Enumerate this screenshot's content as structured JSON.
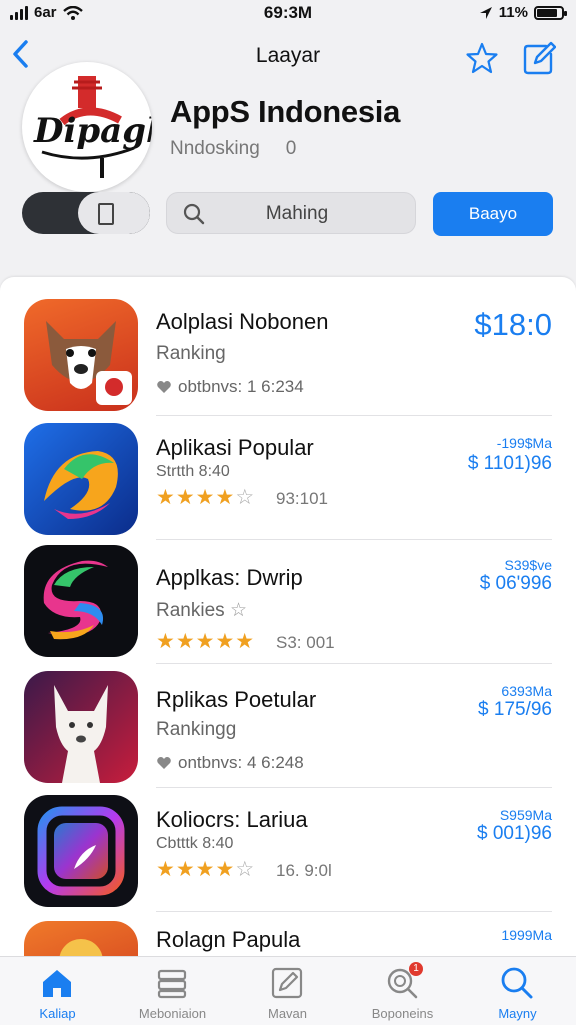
{
  "status_bar": {
    "carrier": "6ar",
    "time": "69:3M",
    "battery_percent": "11%",
    "battery_level": 0.85
  },
  "nav": {
    "title": "Laayar",
    "back_icon": "chevron-left-icon",
    "star_icon": "star-icon",
    "edit_icon": "edit-square-icon"
  },
  "header": {
    "logo_text": "Dipagh",
    "app_title": "AppS Indonesia",
    "sub_label": "Nndosking",
    "sub_count": "0"
  },
  "controls": {
    "search_label": "Mahing",
    "cta_label": "Baayo"
  },
  "apps": [
    {
      "name": "Aolplasi Nobonen",
      "sub": "Ranking",
      "meta": "obtbnvs: 1 6:234",
      "price_big": "$18:0"
    },
    {
      "name": "Aplikasi Popular",
      "sub": "Strtth 8:40",
      "rating": 4,
      "score": "93:101",
      "price_top": "-199$Ma",
      "price": "$ 1101)96"
    },
    {
      "name": "Applkas: Dwrip",
      "sub": "Rankies",
      "rating": 5,
      "score": "S3: 001",
      "price_top": "S39$ve",
      "price": "$ 06'996"
    },
    {
      "name": "Rplikas Poetular",
      "sub": "Rankingg",
      "meta": "ontbnvs: 4 6:248",
      "price_top": "6393Ma",
      "price": "$ 175/96"
    },
    {
      "name": "Koliocrs: Lariua",
      "sub": "Cbtttk 8:40",
      "rating": 4,
      "score": "16. 9:0l",
      "price_top": "S959Ma",
      "price": "$ 001)96"
    },
    {
      "name": "Rolagn Papula",
      "price_top": "1999Ma"
    }
  ],
  "tabs": [
    {
      "label": "Kaliap",
      "icon": "home-icon",
      "active": true
    },
    {
      "label": "Meboniaion",
      "icon": "stack-icon"
    },
    {
      "label": "Mavan",
      "icon": "pencil-square-icon"
    },
    {
      "label": "Boponeins",
      "icon": "search-magnifier-icon",
      "badge": "1"
    },
    {
      "label": "Mayny",
      "icon": "search-icon",
      "active": true
    }
  ],
  "colors": {
    "accent": "#1a7ef0",
    "background": "#f1f1f3",
    "star": "#f0a020",
    "badge": "#e0392e"
  }
}
